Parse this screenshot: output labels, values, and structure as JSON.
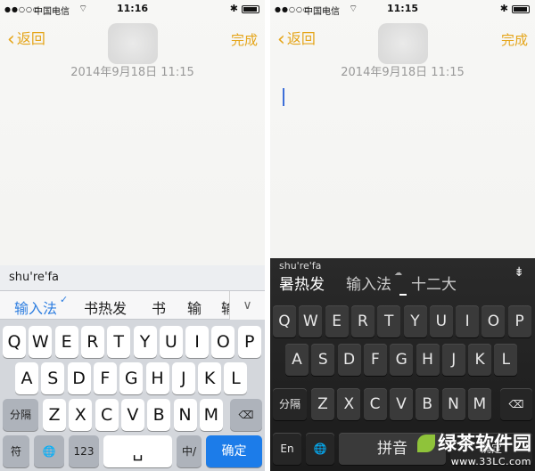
{
  "left": {
    "status": {
      "signal": "●●○○○",
      "carrier": "中国电信",
      "wifi": "⌔",
      "time": "11:16",
      "bluetooth": "✱"
    },
    "nav": {
      "back": "返回",
      "done": "完成"
    },
    "date": "2014年9月18日 11:15",
    "composition": "shu're'fa",
    "candidates": [
      "输入法",
      "书热发",
      "书",
      "输",
      "输"
    ],
    "expand": "∨",
    "rows": [
      [
        "Q",
        "W",
        "E",
        "R",
        "T",
        "Y",
        "U",
        "I",
        "O",
        "P"
      ],
      [
        "A",
        "S",
        "D",
        "F",
        "G",
        "H",
        "J",
        "K",
        "L"
      ],
      [
        "Z",
        "X",
        "C",
        "V",
        "B",
        "N",
        "M"
      ]
    ],
    "keys": {
      "fen": "分隔",
      "fu": "符",
      "globe": "🌐",
      "num": "123",
      "space": "␣",
      "zhong": "中/英",
      "confirm": "确定",
      "delete": "⌫"
    }
  },
  "right": {
    "status": {
      "signal": "●●○○○",
      "carrier": "中国电信",
      "wifi": "⌔",
      "time": "11:15",
      "bluetooth": "✱"
    },
    "nav": {
      "back": "返回",
      "done": "完成"
    },
    "date": "2014年9月18日 11:15",
    "pinyin": "shu're'fa",
    "candidates": [
      "暑热发",
      "输入法",
      "十二大"
    ],
    "collapse": "⇟",
    "rows": [
      [
        "Q",
        "W",
        "E",
        "R",
        "T",
        "Y",
        "U",
        "I",
        "O",
        "P"
      ],
      [
        "A",
        "S",
        "D",
        "F",
        "G",
        "H",
        "J",
        "K",
        "L"
      ],
      [
        "Z",
        "X",
        "C",
        "V",
        "B",
        "N",
        "M"
      ]
    ],
    "keys": {
      "fen": "分隔",
      "en": "En",
      "globe": "🌐",
      "pinyin": "拼音",
      "confirm": "确定",
      "delete": "⌫"
    },
    "watermark": {
      "brand": "绿茶软件园",
      "url": "www.33LC.com"
    }
  }
}
